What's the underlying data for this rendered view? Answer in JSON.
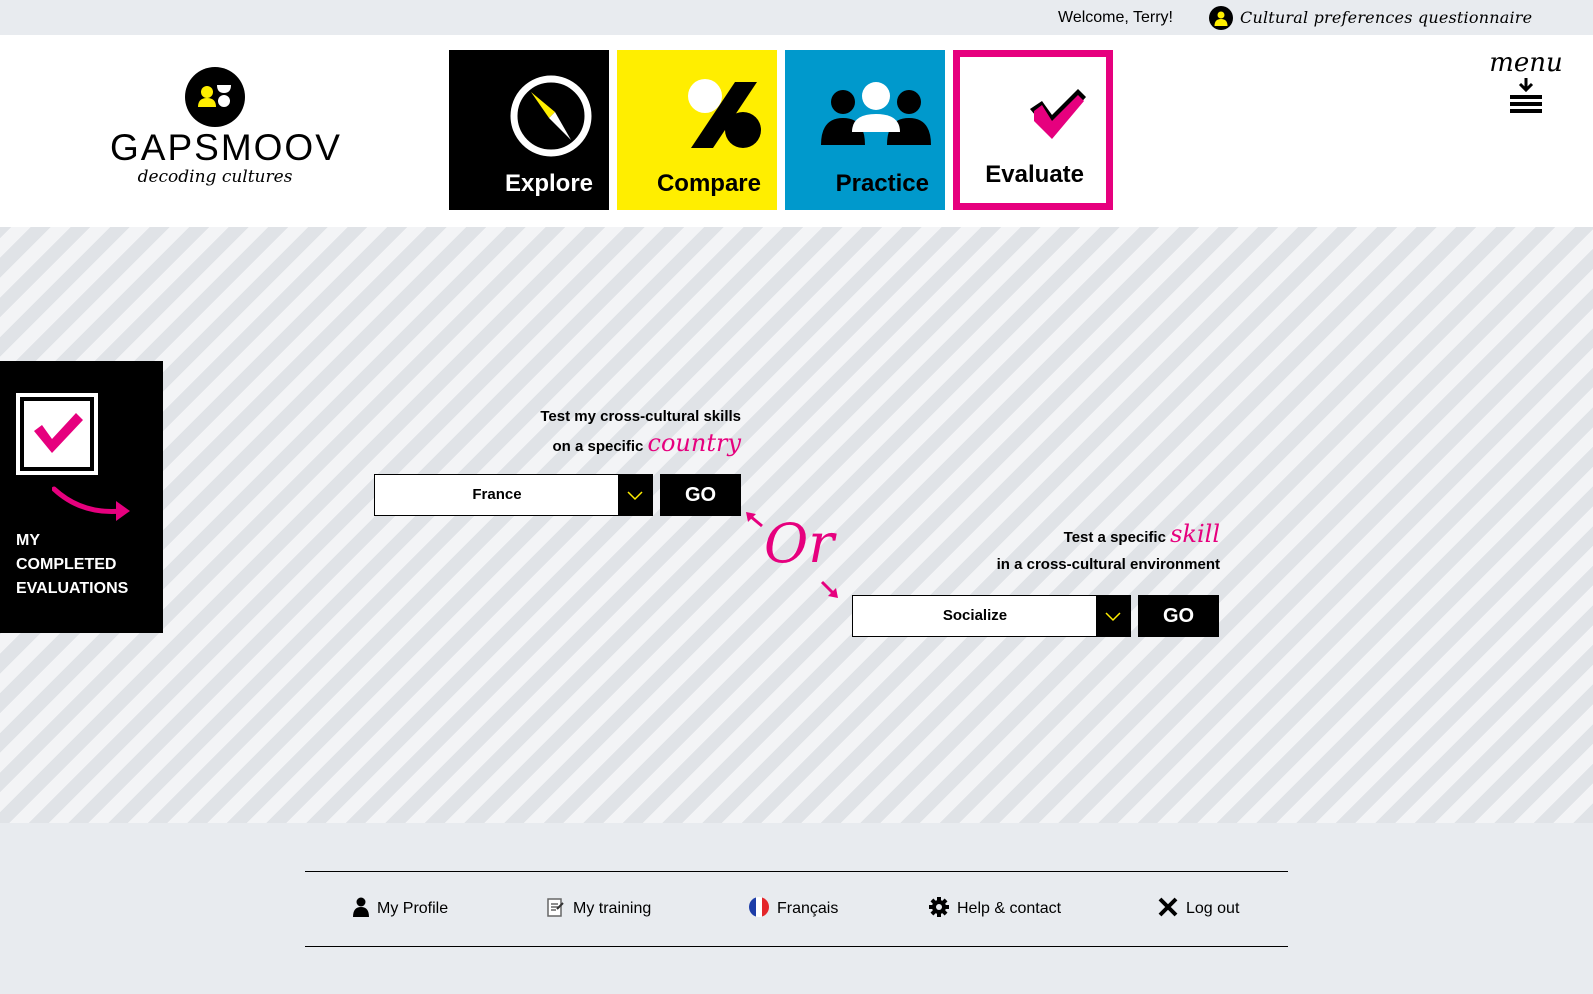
{
  "topbar": {
    "welcome": "Welcome, Terry!",
    "user_icon": "user-icon",
    "questionnaire_link": "Cultural preferences questionnaire"
  },
  "logo": {
    "name": "GAPSMOOV",
    "tagline": "decoding cultures"
  },
  "nav": {
    "tiles": [
      {
        "label": "Explore",
        "icon": "compass-icon",
        "color": "#000000"
      },
      {
        "label": "Compare",
        "icon": "percent-icon",
        "color": "#ffee00"
      },
      {
        "label": "Practice",
        "icon": "people-icon",
        "color": "#0099cc"
      },
      {
        "label": "Evaluate",
        "icon": "checkmark-icon",
        "color": "#e6007e",
        "active": true
      }
    ],
    "menu_label": "menu"
  },
  "completed_panel": {
    "line1": "MY",
    "line2": "COMPLETED",
    "line3": "EVALUATIONS"
  },
  "country_test": {
    "line1": "Test my cross-cultural skills",
    "line2": "on a specific",
    "accent": "country",
    "selected": "France",
    "go_label": "GO"
  },
  "or_label": "Or",
  "skill_test": {
    "line1_prefix": "Test a specific",
    "accent": "skill",
    "line2": "in a cross-cultural environment",
    "selected": "Socialize",
    "go_label": "GO"
  },
  "footer": {
    "profile": "My Profile",
    "training": "My training",
    "language": "Français",
    "help": "Help & contact",
    "logout": "Log out"
  },
  "colors": {
    "accent": "#e6007e",
    "yellow": "#ffee00",
    "blue": "#0099cc"
  }
}
